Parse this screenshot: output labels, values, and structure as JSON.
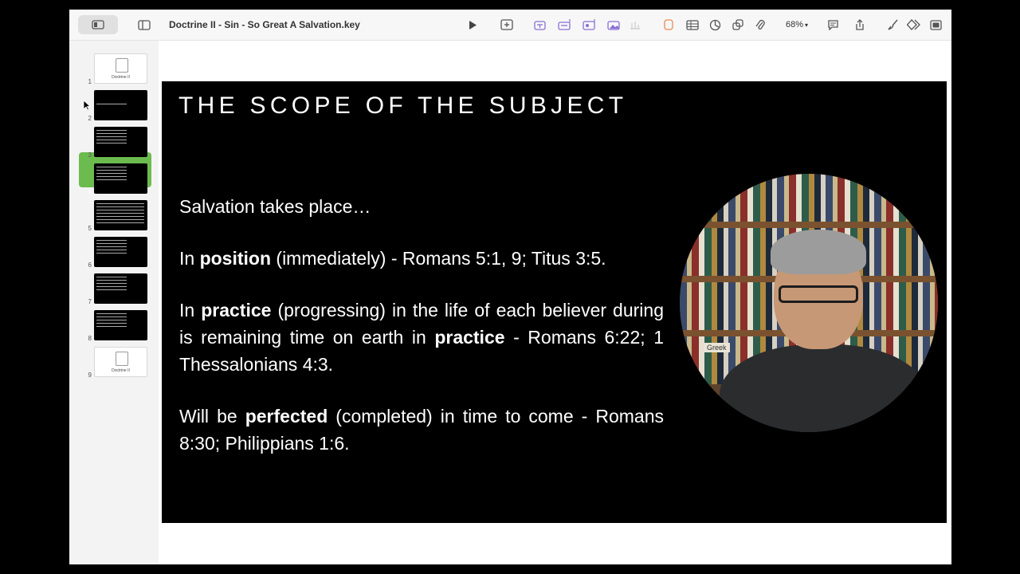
{
  "app": {
    "document_title": "Doctrine II - Sin - So Great A Salvation.key",
    "zoom": "68%"
  },
  "toolbar": {
    "icons": [
      "view-icon",
      "sidebar-icon",
      "play-icon",
      "add-slide-icon",
      "text-icon",
      "chart-icon",
      "shape-icon",
      "media-icon",
      "table-icon",
      "comment-icon",
      "share-icon",
      "format-icon",
      "animate-icon",
      "document-icon"
    ]
  },
  "navigator": {
    "slides": [
      {
        "num": "1",
        "style": "light",
        "label": "Doctrine II"
      },
      {
        "num": "2",
        "style": "dark"
      },
      {
        "num": "3",
        "style": "dark"
      },
      {
        "num": "4",
        "style": "dark",
        "selected": true
      },
      {
        "num": "5",
        "style": "dark"
      },
      {
        "num": "6",
        "style": "dark"
      },
      {
        "num": "7",
        "style": "dark"
      },
      {
        "num": "8",
        "style": "dark"
      },
      {
        "num": "9",
        "style": "light",
        "label": "Doctrine II"
      }
    ],
    "selected_color": "#6cbb4e"
  },
  "slide": {
    "title": "THE SCOPE OF THE SUBJECT",
    "intro": "Salvation takes place…",
    "p1": {
      "pre": "In ",
      "bold": "position",
      "post": " (immediately) - Romans 5:1, 9; Titus 3:5."
    },
    "p2": {
      "pre": "In ",
      "bold": "practice",
      "mid": " (progressing) in the life of each believer during is remaining time on earth in ",
      "bold2": "practice",
      "post": " - Romans 6:22; 1 Thessalonians 4:3."
    },
    "p3": {
      "pre": "Will be ",
      "bold": "perfected",
      "post": " (completed) in time to come - Romans 8:30; Philippians 1:6."
    },
    "book_label": "Greek"
  }
}
